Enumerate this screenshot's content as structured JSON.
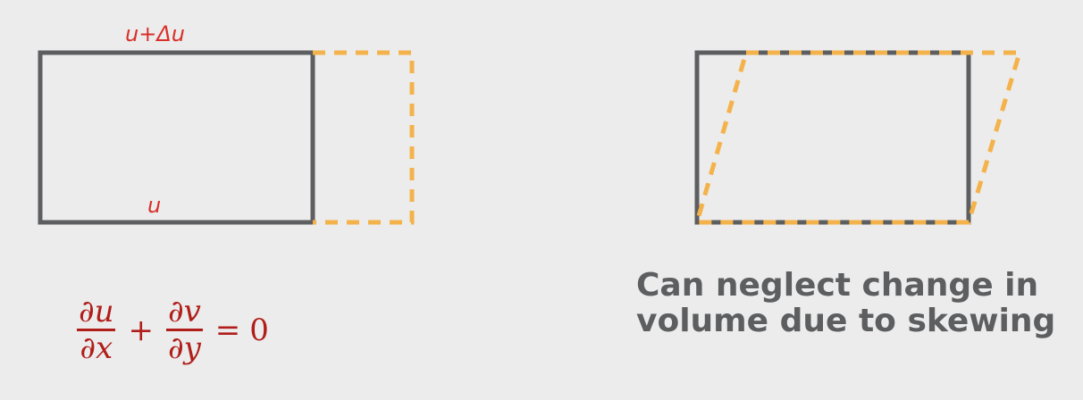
{
  "labels": {
    "top": "u+Δu",
    "bottom": "u"
  },
  "equation": {
    "term1_num": "∂u",
    "term1_den": "∂x",
    "plus": "+",
    "term2_num": "∂v",
    "term2_den": "∂y",
    "equals": "=",
    "rhs": "0"
  },
  "caption": {
    "line1": "Can neglect change in",
    "line2": "volume due to skewing"
  },
  "colors": {
    "background": "#ececec",
    "box": "#5d5e60",
    "dashed": "#f4b24a",
    "annotation": "#d9302a",
    "equation": "#b01e1a"
  }
}
